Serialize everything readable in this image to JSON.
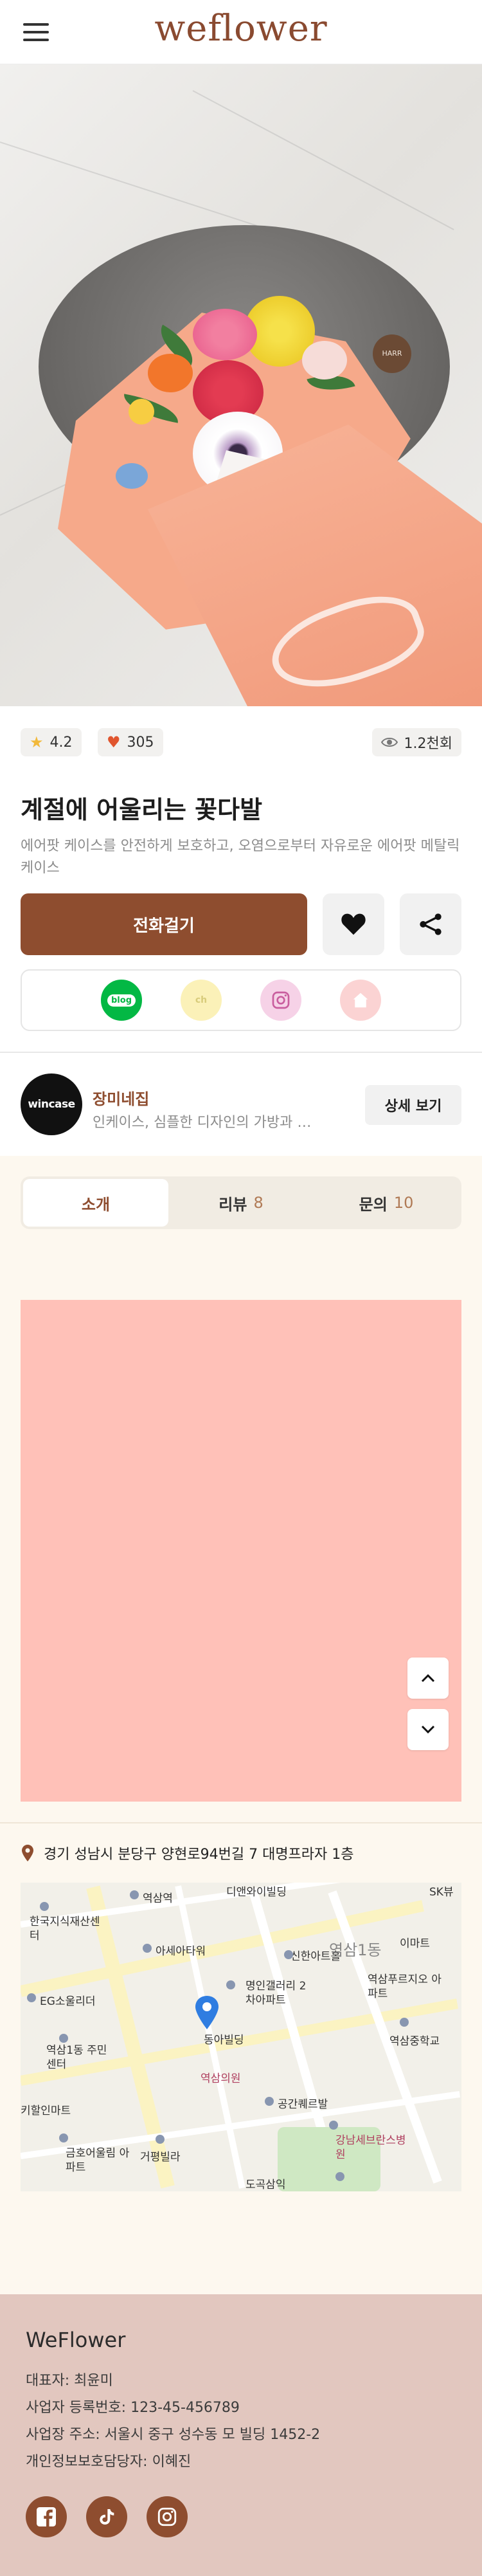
{
  "header": {
    "logo": "weflower",
    "menu_icon": "hamburger-menu-icon"
  },
  "hero": {
    "image_alt": "flower-bouquet-photo",
    "tag_text": "HARR"
  },
  "stats": {
    "rating": "4.2",
    "likes": "305",
    "views": "1.2천회"
  },
  "product": {
    "title": "계절에 어울리는 꽃다발",
    "description": "에어팟 케이스를 안전하게 보호하고, 오염으로부터 자유로운 에어팟 메탈릭 케이스"
  },
  "actions": {
    "call_label": "전화걸기"
  },
  "social_links": [
    {
      "name": "blog",
      "label": "blog"
    },
    {
      "name": "channel",
      "label": "ch"
    },
    {
      "name": "instagram",
      "label": ""
    },
    {
      "name": "home",
      "label": ""
    }
  ],
  "shop": {
    "logo_text": "wincase",
    "name": "장미네집",
    "description": "인케이스, 심플한 디자인의 가방과 액세서리",
    "detail_label": "상세 보기"
  },
  "tabs": [
    {
      "label": "소개",
      "count": ""
    },
    {
      "label": "리뷰",
      "count": "8"
    },
    {
      "label": "문의",
      "count": "10"
    }
  ],
  "location": {
    "address": "경기 성남시 분당구 양현로94번길 7 대명프라자 1층"
  },
  "map": {
    "labels": [
      "역삼역",
      "디앤와이빌딩",
      "SK뷰",
      "한국지식재산센터",
      "아세아타워",
      "신한아트홀",
      "역삼1동",
      "이마트",
      "EG소울리더",
      "명인갤러리 2차아파트",
      "역삼푸르지오 아파트",
      "동아빌딩",
      "역삼1동 주민센터",
      "역삼의원",
      "역삼중학교",
      "키할인마트",
      "공간퀘르발",
      "금호어울림 아파트",
      "거평빌라",
      "강남세브란스병원",
      "도곡삼익"
    ]
  },
  "footer": {
    "title": "WeFlower",
    "ceo": "대표자: 최윤미",
    "business_no": "사업자 등록번호: 123-45-456789",
    "address": "사업장 주소: 서울시 중구 성수동 모 빌딩 1452-2",
    "privacy_officer": "개인정보보호담당자: 이혜진"
  },
  "colors": {
    "brand": "#8e4d2f",
    "accent_pink": "#ffc1b8",
    "footer_bg": "#e2c7bf",
    "content_bg": "#fdf8ef"
  }
}
